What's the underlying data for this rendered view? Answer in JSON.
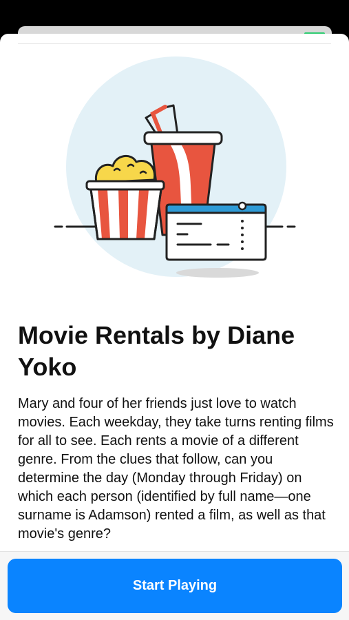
{
  "puzzle": {
    "title": "Movie Rentals by Diane Yoko",
    "description": "Mary and four of her friends just love to watch movies. Each weekday, they take turns renting films for all to see. Each rents a movie of a different genre. From the clues that follow, can you determine the day (Monday through Friday) on which each person (identified by full name—one surname is Adamson) rented a film, as well as that movie's genre?"
  },
  "actions": {
    "start_label": "Start Playing"
  },
  "illustration": {
    "icons": [
      "popcorn-icon",
      "soda-cup-icon",
      "ticket-icon"
    ]
  },
  "colors": {
    "accent": "#0a84ff",
    "illustration_circle": "#e3f1f7",
    "red": "#e8553f",
    "ticket_blue": "#2f9bd6",
    "popcorn_yellow": "#f7d74a"
  }
}
